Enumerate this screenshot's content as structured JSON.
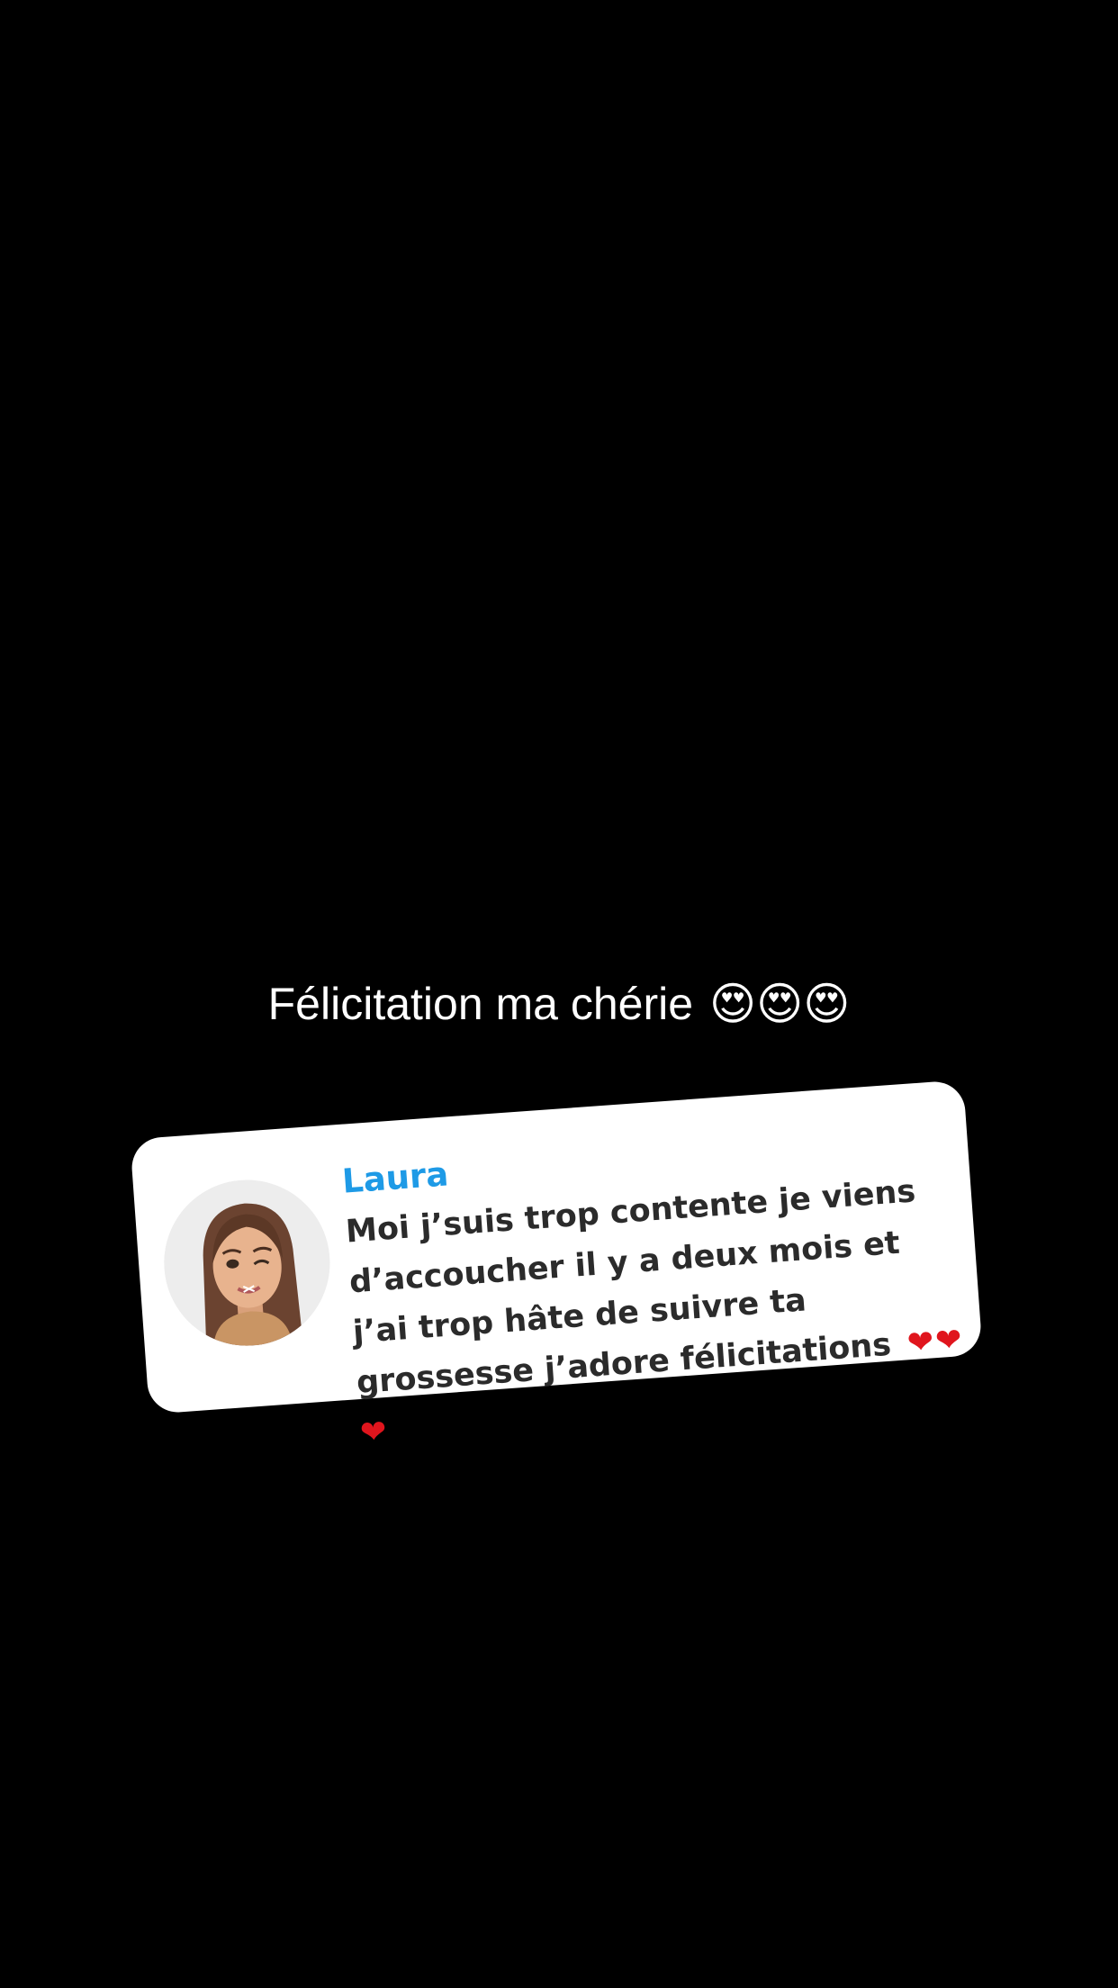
{
  "caption": {
    "text": "Félicitation ma chérie",
    "emojis": "😍😍😍"
  },
  "reply_card": {
    "username": "Laura",
    "message": "Moi j’suis trop contente je viens d’accoucher il y a deux mois et j’ai trop hâte de suivre ta grossesse j’adore félicitations",
    "hearts": "❤❤❤",
    "colors": {
      "username": "#1e9ae6",
      "message": "#2b2b2b",
      "card_background": "#ffffff",
      "hearts": "#e0151d"
    },
    "avatar_icon": "bitmoji-avatar-icon"
  }
}
